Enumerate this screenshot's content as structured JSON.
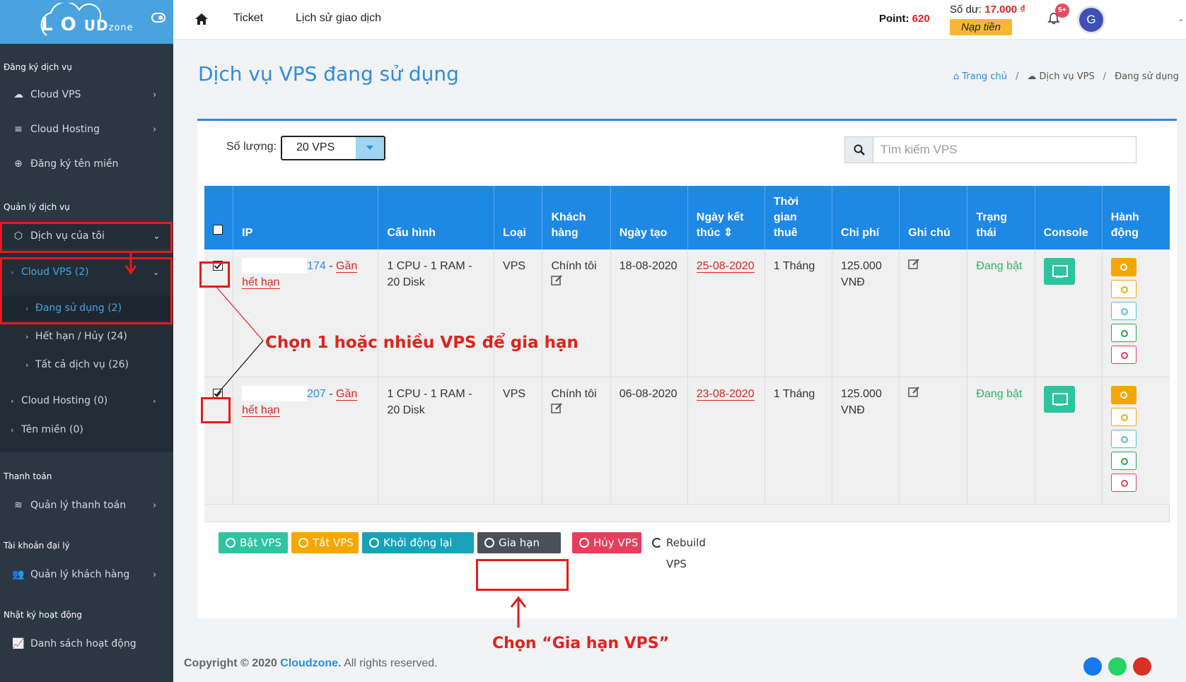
{
  "brand": {
    "logo_text_main": "L",
    "logo_text_ud": "UD",
    "logo_text_zone": "zone"
  },
  "sidebar": {
    "section1": "Đăng ký dịch vụ",
    "cloud_vps": "Cloud VPS",
    "cloud_hosting": "Cloud Hosting",
    "domain_register": "Đăng ký tên miền",
    "section2": "Quản lý dịch vụ",
    "my_services": "Dịch vụ của tôi",
    "sub_cloud_vps": "Cloud VPS (2)",
    "sub_in_use": "Đang sử dụng (2)",
    "sub_expired": "Hết hạn / Hủy (24)",
    "sub_all": "Tất cả dịch vụ (26)",
    "sub_cloud_hosting": "Cloud Hosting (0)",
    "sub_domain": "Tên miền (0)",
    "section3": "Thanh toán",
    "payment_manage": "Quản lý thanh toán",
    "section4": "Tài khoản đại lý",
    "customer_manage": "Quản lý khách hàng",
    "section5": "Nhật ký hoạt động",
    "activity_list": "Danh sách hoạt động"
  },
  "topbar": {
    "ticket": "Ticket",
    "history": "Lịch sử giao dịch",
    "point_label": "Point:",
    "point_value": "620",
    "balance_label": "Số dư:",
    "balance_value": "17.000 ₫",
    "topup": "Nạp tiền",
    "notif_count": "5+",
    "avatar_letter": "G"
  },
  "page": {
    "title": "Dịch vụ VPS đang sử dụng",
    "breadcrumb": [
      "Trang chủ",
      "Dịch vụ VPS",
      "Đang sử dụng"
    ]
  },
  "controls": {
    "qty_label": "Số lượng:",
    "qty_value": "20 VPS",
    "search_placeholder": "Tìm kiếm VPS"
  },
  "table": {
    "headers": [
      "IP",
      "Cấu hình",
      "Loại",
      "Khách hàng",
      "Ngày tạo",
      "Ngày kết thúc",
      "Thời gian thuê",
      "Chi phí",
      "Ghi chú",
      "Trạng thái",
      "Console",
      "Hành động"
    ],
    "rows": [
      {
        "ip_suffix": "174",
        "near_expire": "Gần hết hạn",
        "config": "1 CPU - 1 RAM - 20 Disk",
        "type": "VPS",
        "customer": "Chính tôi",
        "created": "18-08-2020",
        "end": "25-08-2020",
        "duration": "1 Tháng",
        "cost": "125.000 VNĐ",
        "status": "Đang bật"
      },
      {
        "ip_suffix": "207",
        "near_expire": "Gần hết hạn",
        "config": "1 CPU - 1 RAM - 20 Disk",
        "type": "VPS",
        "customer": "Chính tôi",
        "created": "06-08-2020",
        "end": "23-08-2020",
        "duration": "1 Tháng",
        "cost": "125.000 VNĐ",
        "status": "Đang bật"
      }
    ]
  },
  "actions": {
    "on": "Bật VPS",
    "off": "Tắt VPS",
    "restart": "Khởi động lại VPS",
    "extend": "Gia hạn VPS",
    "cancel": "Hủy VPS",
    "rebuild": "Rebuild VPS"
  },
  "footer": {
    "copyright": "Copyright © 2020",
    "brand": "Cloudzone.",
    "rights": "All rights reserved."
  },
  "annotations": {
    "select_text": "Chọn 1 hoặc nhiều VPS để gia hạn",
    "extend_text": "Chọn “Gia hạn VPS”"
  },
  "colors": {
    "accent": "#2c8de0",
    "sidebar": "#2c3744",
    "annotation": "#e0231d"
  }
}
